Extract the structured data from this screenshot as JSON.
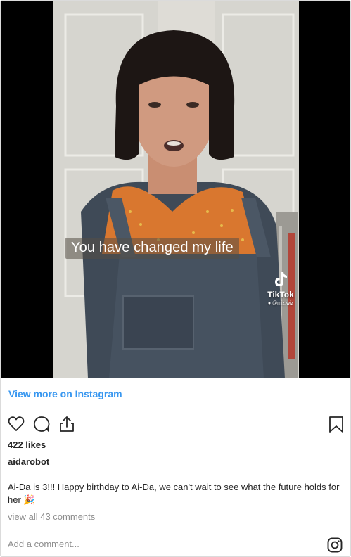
{
  "video": {
    "caption": "You have changed my life",
    "watermark_brand": "TikTok",
    "watermark_handle": "@miz.wiz"
  },
  "post": {
    "view_more_label": "View more on Instagram",
    "likes": "422 likes",
    "username": "aidarobot",
    "caption": "Ai-Da is 3!!! Happy birthday to Ai-Da, we can't wait to see what the future holds for her 🎉",
    "view_comments": "view all 43 comments",
    "comment_placeholder": "Add a comment..."
  },
  "icons": {
    "like": "heart-icon",
    "comment": "comment-bubble-icon",
    "share": "share-icon",
    "save": "bookmark-icon",
    "brand": "instagram-icon"
  },
  "colors": {
    "link": "#3897f0",
    "text": "#262626",
    "muted": "#8e8e8e",
    "border": "#dbdbdb"
  }
}
